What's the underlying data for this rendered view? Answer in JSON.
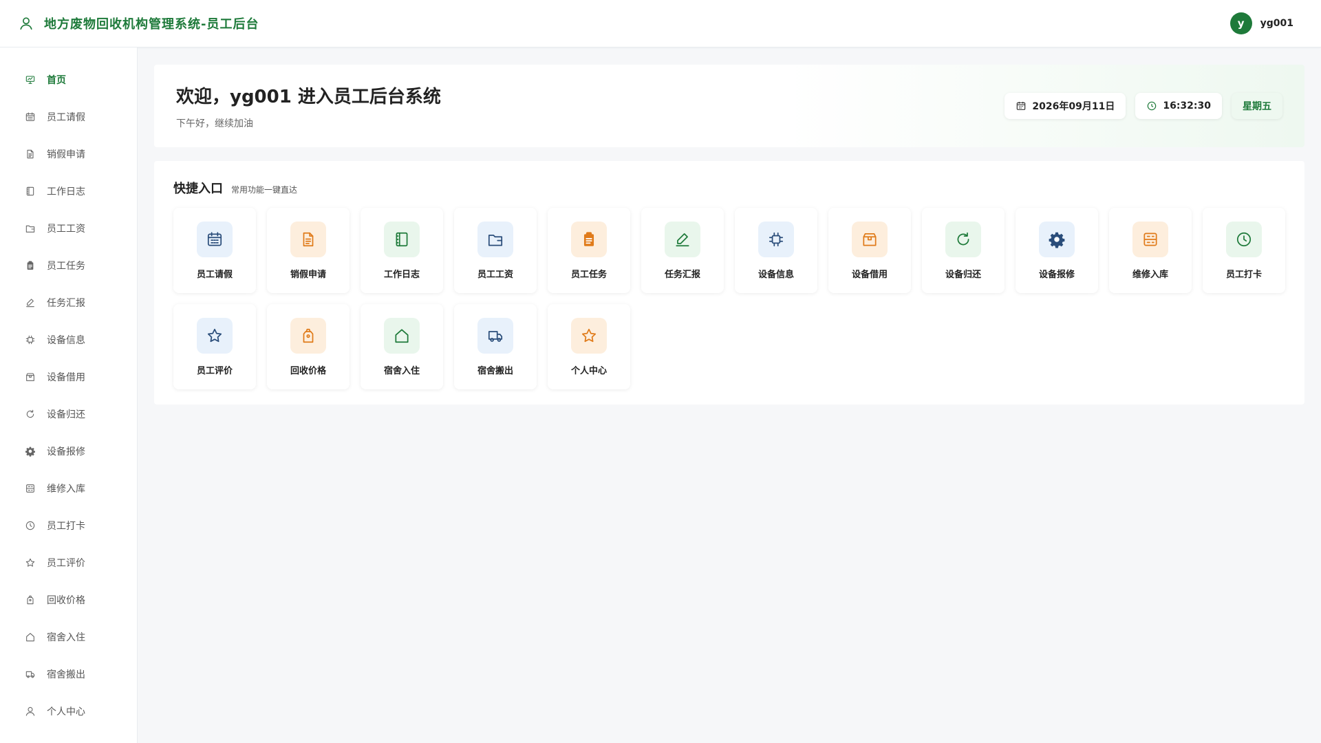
{
  "header": {
    "title": "地方废物回收机构管理系统-员工后台",
    "brand_icon": "user-icon"
  },
  "user": {
    "avatar_letter": "y",
    "name": "yg001"
  },
  "sidebar": {
    "items": [
      {
        "label": "首页",
        "icon": "home-monitor-icon",
        "active": true
      },
      {
        "label": "员工请假",
        "icon": "calendar-icon"
      },
      {
        "label": "销假申请",
        "icon": "document-icon"
      },
      {
        "label": "工作日志",
        "icon": "notebook-icon"
      },
      {
        "label": "员工工资",
        "icon": "wallet-icon"
      },
      {
        "label": "员工任务",
        "icon": "clipboard-icon"
      },
      {
        "label": "任务汇报",
        "icon": "edit-icon"
      },
      {
        "label": "设备信息",
        "icon": "chip-icon"
      },
      {
        "label": "设备借用",
        "icon": "box-icon"
      },
      {
        "label": "设备归还",
        "icon": "refresh-icon"
      },
      {
        "label": "设备报修",
        "icon": "gear-icon"
      },
      {
        "label": "维修入库",
        "icon": "storage-icon"
      },
      {
        "label": "员工打卡",
        "icon": "clock-icon"
      },
      {
        "label": "员工评价",
        "icon": "star-icon"
      },
      {
        "label": "回收价格",
        "icon": "price-tag-icon"
      },
      {
        "label": "宿舍入住",
        "icon": "house-icon"
      },
      {
        "label": "宿舍搬出",
        "icon": "truck-icon"
      },
      {
        "label": "个人中心",
        "icon": "user-icon"
      }
    ]
  },
  "welcome": {
    "title": "欢迎，yg001 进入员工后台系统",
    "subtitle": "下午好，继续加油",
    "date": "2026年09月11日",
    "time": "16:32:30",
    "weekday": "星期五"
  },
  "quick": {
    "title": "快捷入口",
    "subtitle": "常用功能一键直达",
    "cards": [
      {
        "label": "员工请假",
        "icon": "calendar-icon",
        "tone": "blue"
      },
      {
        "label": "销假申请",
        "icon": "document-icon",
        "tone": "orange"
      },
      {
        "label": "工作日志",
        "icon": "notebook-icon",
        "tone": "green"
      },
      {
        "label": "员工工资",
        "icon": "wallet-icon",
        "tone": "blue"
      },
      {
        "label": "员工任务",
        "icon": "clipboard-icon",
        "tone": "orange"
      },
      {
        "label": "任务汇报",
        "icon": "edit-icon",
        "tone": "green"
      },
      {
        "label": "设备信息",
        "icon": "chip-icon",
        "tone": "blue"
      },
      {
        "label": "设备借用",
        "icon": "box-icon",
        "tone": "orange"
      },
      {
        "label": "设备归还",
        "icon": "refresh-icon",
        "tone": "green"
      },
      {
        "label": "设备报修",
        "icon": "gear-icon",
        "tone": "blue"
      },
      {
        "label": "维修入库",
        "icon": "storage-icon",
        "tone": "orange"
      },
      {
        "label": "员工打卡",
        "icon": "clock-icon",
        "tone": "green"
      },
      {
        "label": "员工评价",
        "icon": "star-icon",
        "tone": "blue"
      },
      {
        "label": "回收价格",
        "icon": "price-tag-icon",
        "tone": "orange"
      },
      {
        "label": "宿舍入住",
        "icon": "house-icon",
        "tone": "green"
      },
      {
        "label": "宿舍搬出",
        "icon": "truck-icon",
        "tone": "blue"
      },
      {
        "label": "个人中心",
        "icon": "star-icon",
        "tone": "orange"
      }
    ]
  },
  "colors": {
    "brand": "#1e7a3a",
    "icon_blue": "#2a4d7a",
    "icon_orange": "#e07b1a",
    "icon_green": "#1e7a3a",
    "sidebar_icon": "#666666"
  }
}
